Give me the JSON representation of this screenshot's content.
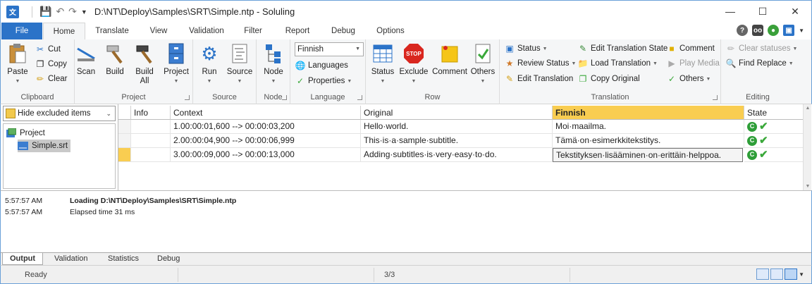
{
  "window": {
    "title": "D:\\NT\\Deploy\\Samples\\SRT\\Simple.ntp  -  Soluling",
    "app_icon": "soluling-app-icon",
    "controls": [
      "minimize-icon",
      "maximize-icon",
      "close-icon"
    ]
  },
  "ribbon_tabs": [
    "File",
    "Home",
    "Translate",
    "View",
    "Validation",
    "Filter",
    "Report",
    "Debug",
    "Options"
  ],
  "active_tab": "Home",
  "groups": {
    "clipboard": {
      "label": "Clipboard",
      "paste": "Paste",
      "cut": "Cut",
      "copy": "Copy",
      "clear": "Clear"
    },
    "project": {
      "label": "Project",
      "scan": "Scan",
      "build": "Build",
      "build_all_1": "Build",
      "build_all_2": "All",
      "project": "Project"
    },
    "source": {
      "label": "Source",
      "run": "Run",
      "source": "Source"
    },
    "node": {
      "label": "Node",
      "node": "Node"
    },
    "language": {
      "label": "Language",
      "selected": "Finnish",
      "languages": "Languages",
      "properties": "Properties"
    },
    "row": {
      "label": "Row",
      "status": "Status",
      "exclude": "Exclude",
      "comment": "Comment",
      "others": "Others"
    },
    "translation": {
      "label": "Translation",
      "status": "Status",
      "review_status": "Review Status",
      "edit_translation": "Edit Translation",
      "edit_translation_state": "Edit Translation State",
      "load_translation": "Load Translation",
      "copy_original": "Copy Original",
      "comment": "Comment",
      "play_media": "Play Media",
      "others": "Others"
    },
    "editing": {
      "label": "Editing",
      "clear_statuses": "Clear statuses",
      "find_replace": "Find Replace"
    }
  },
  "filter": {
    "selected": "Hide excluded items"
  },
  "tree": {
    "root": "Project",
    "child": "Simple.srt"
  },
  "grid": {
    "columns": [
      "Info",
      "Context",
      "Original",
      "Finnish",
      "State"
    ],
    "rows": [
      {
        "context": "1.00:00:01,600 --> 00:00:03,200",
        "original": "Hello·world.",
        "finnish": "Moi·maailma.",
        "state": "C"
      },
      {
        "context": "2.00:00:04,900 --> 00:00:06,999",
        "original": "This·is·a·sample·subtitle.",
        "finnish": "Tämä·on·esimerkkitekstitys.",
        "state": "C"
      },
      {
        "context": "3.00:00:09,000 --> 00:00:13,000",
        "original": "Adding·subtitles·is·very·easy·to·do.",
        "finnish": "Tekstityksen·lisääminen·on·erittäin·helppoa.",
        "state": "C"
      }
    ]
  },
  "output": {
    "lines": [
      {
        "time": "5:57:57 AM",
        "message": "Loading D:\\NT\\Deploy\\Samples\\SRT\\Simple.ntp"
      },
      {
        "time": "5:57:57 AM",
        "message": "Elapsed time 31 ms"
      }
    ],
    "tabs": [
      "Output",
      "Validation",
      "Statistics",
      "Debug"
    ]
  },
  "statusbar": {
    "state": "Ready",
    "count": "3/3"
  },
  "colors": {
    "file_tab": "#2b73c8",
    "highlight": "#f9cd51",
    "ok_green": "#2e9e38"
  }
}
